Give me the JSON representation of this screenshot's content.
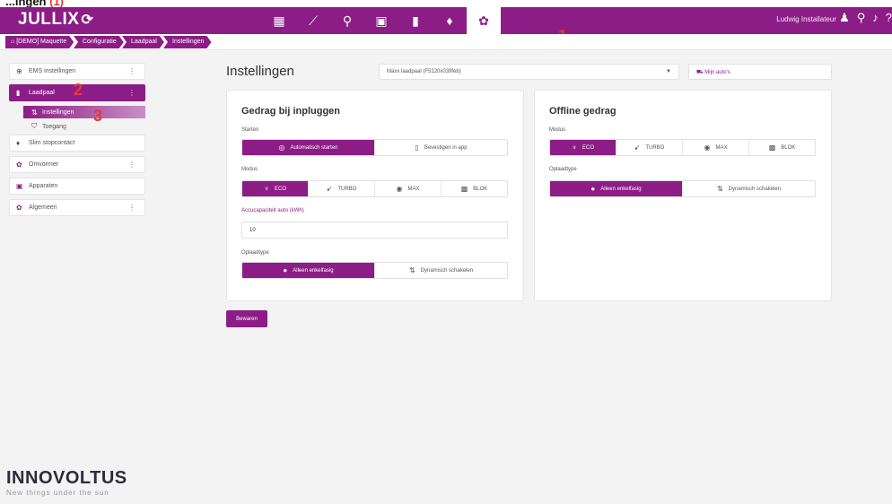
{
  "topclip": {
    "text": "...ingen",
    "number": "(1)"
  },
  "app": {
    "title": "JULLIX"
  },
  "nav": {
    "icons": [
      {
        "name": "dashboard-icon",
        "glyph": "▦"
      },
      {
        "name": "chart-icon",
        "glyph": "⟋"
      },
      {
        "name": "analytics-icon",
        "glyph": "⚲"
      },
      {
        "name": "device-icon",
        "glyph": "▣"
      },
      {
        "name": "battery-icon",
        "glyph": "▮"
      },
      {
        "name": "plug-icon",
        "glyph": "♦"
      },
      {
        "name": "settings-icon",
        "glyph": "✿"
      }
    ],
    "active_index": 6
  },
  "header": {
    "user": "Ludwig Installateur"
  },
  "markers": {
    "m1": "1",
    "m2": "2",
    "m3": "3"
  },
  "breadcrumbs": [
    "[DEMO] Maquette",
    "Configuratie",
    "Laadpaal",
    "Instellingen"
  ],
  "sidebar": {
    "items": [
      {
        "label": "EMS instellingen",
        "icon": "⊕",
        "dots": "⋮"
      },
      {
        "label": "Laadpaal",
        "icon": "▮",
        "dots": "⋮"
      },
      {
        "label": "Slim stopcontact",
        "icon": "♦",
        "dots": ""
      },
      {
        "label": "Omvormer",
        "icon": "✿",
        "dots": "⋮"
      },
      {
        "label": "Apparaten",
        "icon": "▣",
        "dots": ""
      },
      {
        "label": "Algemeen",
        "icon": "✿",
        "dots": "⋮"
      }
    ],
    "subitems": [
      {
        "label": "Instellingen",
        "icon": "⇅"
      },
      {
        "label": "Toegang",
        "icon": "⛉"
      }
    ]
  },
  "main": {
    "title": "Instellingen",
    "charger_select": "Maxx laadpaal (F5120x039feb)",
    "cars_button": "Mijn auto's",
    "save_label": "Bewaren"
  },
  "plugin_card": {
    "title": "Gedrag bij inpluggen",
    "start_label": "Starten",
    "start_options": [
      "Automatisch starten",
      "Bevestigen in app"
    ],
    "mode_label": "Modus",
    "mode_options": [
      "ECO",
      "TURBO",
      "MAX",
      "BLOK"
    ],
    "capacity_label": "Accucapaciteit auto (kWh)",
    "capacity_value": "10",
    "phase_label": "Oplaadtype",
    "phase_options": [
      "Alleen enkelfasig",
      "Dynamisch schakelen"
    ]
  },
  "offline_card": {
    "title": "Offline gedrag",
    "mode_label": "Modus",
    "mode_options": [
      "ECO",
      "TURBO",
      "MAX",
      "BLOK"
    ],
    "phase_label": "Oplaadtype",
    "phase_options": [
      "Alleen enkelfasig",
      "Dynamisch schakelen"
    ]
  },
  "brand": {
    "name": "INNOVOLTUS",
    "tagline": "New things under the sun"
  },
  "colors": {
    "primary": "#8c1d86",
    "marker": "#e53935",
    "background": "#f3f3f3"
  }
}
